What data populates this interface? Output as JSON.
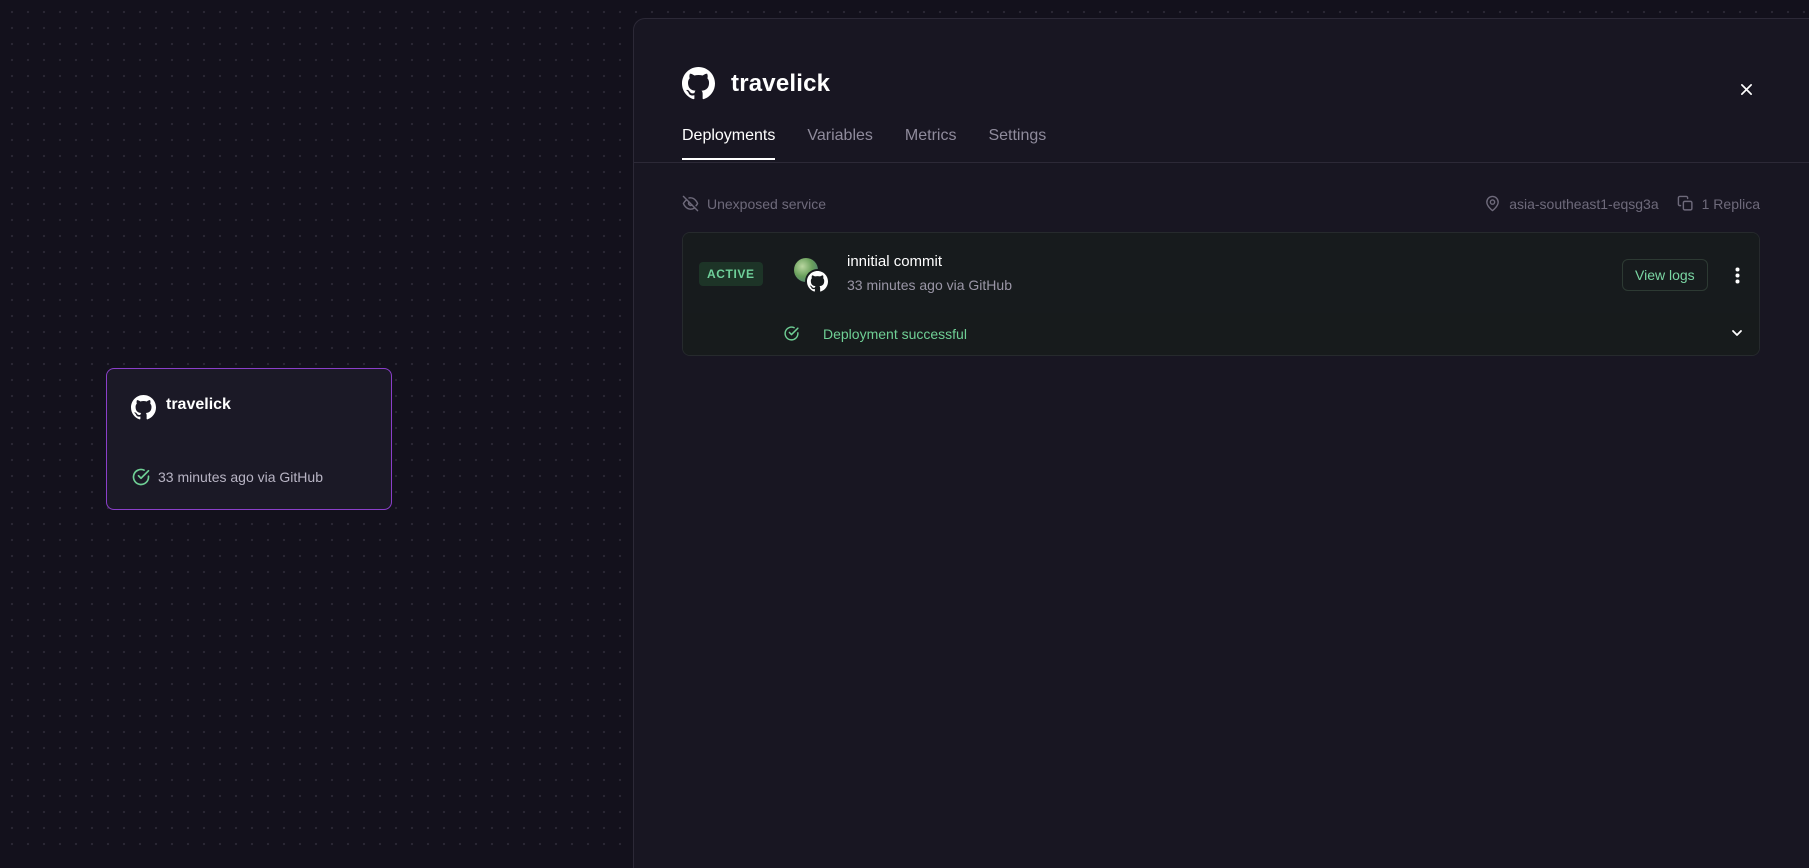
{
  "service_card": {
    "icon": "github-icon",
    "title": "travelick",
    "status_icon": "check-circle-icon",
    "status_text": "33 minutes ago via GitHub",
    "border_color": "#8a3fc9"
  },
  "panel": {
    "icon": "github-icon",
    "title": "travelick",
    "close_icon": "close-icon",
    "tabs": [
      {
        "label": "Deployments",
        "active": true
      },
      {
        "label": "Variables",
        "active": false
      },
      {
        "label": "Metrics",
        "active": false
      },
      {
        "label": "Settings",
        "active": false
      }
    ],
    "meta": {
      "exposure_icon": "eye-off-icon",
      "exposure": "Unexposed service",
      "region_icon": "map-pin-icon",
      "region": "asia-southeast1-eqsg3a",
      "replica_icon": "copy-icon",
      "replicas": "1 Replica"
    },
    "deployment": {
      "badge": "ACTIVE",
      "avatar": "user-avatar",
      "source_icon": "github-icon",
      "commit_message": "innitial commit",
      "commit_meta": "33 minutes ago via GitHub",
      "view_logs_label": "View logs",
      "menu_icon": "kebab-menu-icon",
      "status_icon": "check-circle-icon",
      "status_text": "Deployment successful",
      "expand_icon": "chevron-down-icon",
      "success_color": "#6fcf95"
    }
  }
}
